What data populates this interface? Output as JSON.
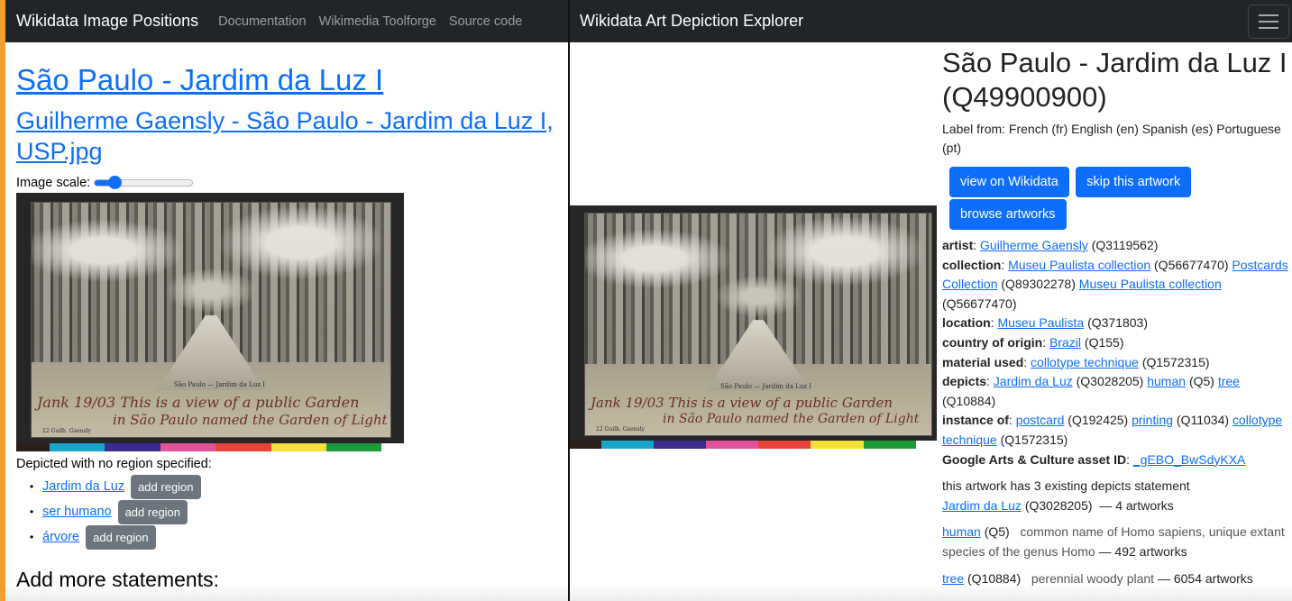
{
  "left": {
    "navbar": {
      "brand": "Wikidata Image Positions",
      "links": [
        "Documentation",
        "Wikimedia Toolforge",
        "Source code"
      ]
    },
    "title": "São Paulo - Jardim da Luz I",
    "file_title": "Guilherme Gaensly - São Paulo - Jardim da Luz I, USP.jpg",
    "image_scale_label": "Image scale:",
    "image_scale_value": 0.1,
    "depicted_title": "Depicted with no region specified:",
    "depicted_items": [
      {
        "label": "Jardim da Luz",
        "button": "add region"
      },
      {
        "label": "ser humano",
        "button": "add region"
      },
      {
        "label": "árvore",
        "button": "add region"
      }
    ],
    "add_more_heading": "Add more statements:"
  },
  "artwork": {
    "caption": "São Paulo — Jardim da Luz I",
    "handwriting_line1": "Jank 19/03  This is a view of a public Garden",
    "handwriting_line2": "in São Paulo named the Garden of Light",
    "imprint": "22  Guilh. Gaensly",
    "colorbar": [
      "#2b1d1a",
      "#17a6c9",
      "#3a2d8f",
      "#e0529c",
      "#e8443a",
      "#f6e13a",
      "#1d9a3a",
      "#ffffff"
    ]
  },
  "right": {
    "navbar": {
      "brand": "Wikidata Art Depiction Explorer"
    },
    "title": "São Paulo - Jardim da Luz I (Q49900900)",
    "label_from": "Label from: French (fr) English (en) Spanish (es) Portuguese (pt)",
    "buttons": [
      "view on Wikidata",
      "skip this artwork",
      "browse artworks"
    ],
    "props": {
      "artist_label": "artist",
      "artist": "Guilherme Gaensly",
      "artist_id": "(Q3119562)",
      "collection_label": "collection",
      "collection1": "Museu Paulista collection",
      "collection1_id": "(Q56677470)",
      "collection2": "Postcards Collection",
      "collection2_id": "(Q89302278)",
      "collection3": "Museu Paulista collection",
      "collection3_id": "(Q56677470)",
      "location_label": "location",
      "location": "Museu Paulista",
      "location_id": "(Q371803)",
      "country_label": "country of origin",
      "country": "Brazil",
      "country_id": "(Q155)",
      "material_label": "material used",
      "material": "collotype technique",
      "material_id": "(Q1572315)",
      "depicts_label": "depicts",
      "depicts1": "Jardim da Luz",
      "depicts1_id": "(Q3028205)",
      "depicts2": "human",
      "depicts2_id": "(Q5)",
      "depicts3": "tree",
      "depicts3_id": "(Q10884)",
      "instance_label": "instance of",
      "instance1": "postcard",
      "instance1_id": "(Q192425)",
      "instance2": "printing",
      "instance2_id": "(Q11034)",
      "instance3": "collotype technique",
      "instance3_id": "(Q1572315)",
      "gac_label": "Google Arts & Culture asset ID",
      "gac": "_gEBO_BwSdyKXA"
    },
    "existing_text": "this artwork has 3 existing depicts statement",
    "existing": [
      {
        "label": "Jardim da Luz",
        "id": "(Q3028205)",
        "desc": "",
        "count": "— 4 artworks"
      },
      {
        "label": "human",
        "id": "(Q5)",
        "desc": "common name of Homo sapiens, unique extant species of the genus Homo",
        "count": "— 492 artworks"
      },
      {
        "label": "tree",
        "id": "(Q10884)",
        "desc": "perennial woody plant",
        "count": "— 6054 artworks"
      }
    ]
  }
}
